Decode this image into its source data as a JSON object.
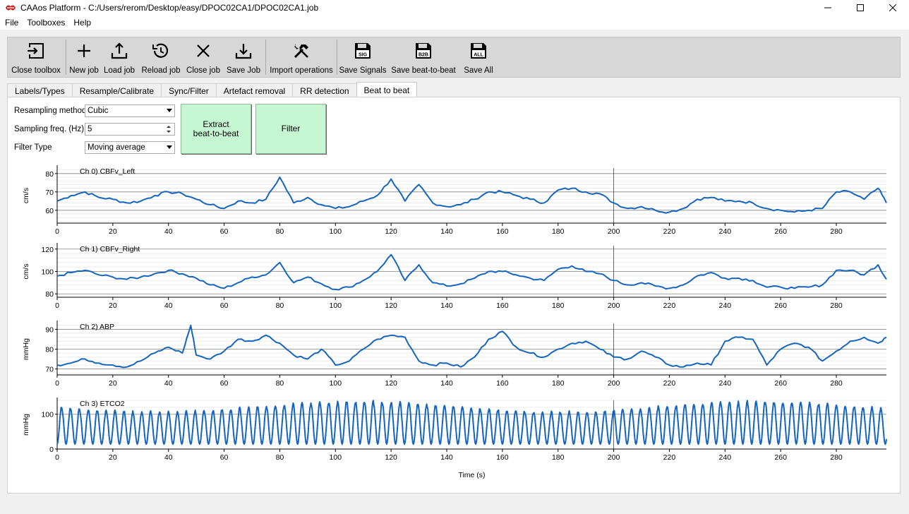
{
  "window": {
    "title": "CAAos Platform - C:/Users/rerom/Desktop/easy/DPOC02CA1/DPOC02CA1.job"
  },
  "menu": [
    "File",
    "Toolboxes",
    "Help"
  ],
  "toolbar": {
    "close_toolbox": "Close toolbox",
    "new_job": "New job",
    "load_job": "Load job",
    "reload_job": "Reload job",
    "close_job": "Close job",
    "save_job": "Save Job",
    "import_operations": "Import operations",
    "save_signals": "Save Signals",
    "save_b2b": "Save beat-to-beat",
    "save_all": "Save All",
    "icon_sig": "SIG",
    "icon_b2b": "B2B",
    "icon_all": "ALL"
  },
  "tabs": [
    "Labels/Types",
    "Resample/Calibrate",
    "Sync/Filter",
    "Artefact removal",
    "RR detection",
    "Beat to beat"
  ],
  "controls": {
    "resampling_method_label": "Resampling method",
    "resampling_method_value": "Cubic",
    "sampling_freq_label": "Sampling freq. (Hz)",
    "sampling_freq_value": "5",
    "filter_type_label": "Filter Type",
    "filter_type_value": "Moving average",
    "extract_btn_line1": "Extract",
    "extract_btn_line2": "beat-to-beat",
    "filter_btn": "Filter"
  },
  "colors": {
    "signal": "#1565c0",
    "action_button": "#c6f7d3"
  },
  "chart_data": [
    {
      "type": "line",
      "title": "Ch 0) CBFv_Left",
      "ylabel": "cm/s",
      "xlim": [
        0,
        298
      ],
      "ylim": [
        53,
        83
      ],
      "yticks": [
        60,
        70,
        80
      ],
      "xticks": [
        0,
        20,
        40,
        60,
        80,
        100,
        120,
        140,
        160,
        180,
        200,
        220,
        240,
        260,
        280
      ],
      "x": [
        0,
        5,
        10,
        15,
        20,
        25,
        30,
        35,
        40,
        45,
        50,
        55,
        60,
        65,
        70,
        75,
        80,
        85,
        90,
        95,
        100,
        105,
        110,
        115,
        120,
        125,
        130,
        135,
        140,
        145,
        150,
        155,
        160,
        165,
        170,
        175,
        180,
        185,
        190,
        195,
        200,
        205,
        210,
        215,
        220,
        225,
        230,
        235,
        240,
        245,
        250,
        255,
        260,
        265,
        270,
        275,
        280,
        285,
        290,
        295,
        298
      ],
      "y": [
        65,
        68,
        70,
        67,
        66,
        64,
        65,
        68,
        70,
        69,
        66,
        63,
        61,
        65,
        64,
        66,
        78,
        64,
        67,
        63,
        61,
        62,
        65,
        68,
        77,
        65,
        74,
        64,
        62,
        63,
        66,
        70,
        70,
        68,
        66,
        64,
        71,
        72,
        70,
        69,
        64,
        61,
        62,
        60,
        59,
        61,
        66,
        67,
        65,
        65,
        64,
        61,
        60,
        59,
        60,
        61,
        70,
        70,
        66,
        72,
        64
      ]
    },
    {
      "type": "line",
      "title": "Ch 1) CBFv_Right",
      "ylabel": "cm/s",
      "xlim": [
        0,
        298
      ],
      "ylim": [
        77,
        123
      ],
      "yticks": [
        80,
        100,
        120
      ],
      "xticks": [
        0,
        20,
        40,
        60,
        80,
        100,
        120,
        140,
        160,
        180,
        200,
        220,
        240,
        260,
        280
      ],
      "x": [
        0,
        5,
        10,
        15,
        20,
        25,
        30,
        35,
        40,
        45,
        50,
        55,
        60,
        65,
        70,
        75,
        80,
        85,
        90,
        95,
        100,
        105,
        110,
        115,
        120,
        125,
        130,
        135,
        140,
        145,
        150,
        155,
        160,
        165,
        170,
        175,
        180,
        185,
        190,
        195,
        200,
        205,
        210,
        215,
        220,
        225,
        230,
        235,
        240,
        245,
        250,
        255,
        260,
        265,
        270,
        275,
        280,
        285,
        290,
        295,
        298
      ],
      "y": [
        96,
        99,
        101,
        97,
        95,
        93,
        95,
        98,
        101,
        98,
        94,
        88,
        85,
        90,
        95,
        97,
        108,
        90,
        95,
        89,
        84,
        86,
        92,
        100,
        115,
        92,
        106,
        90,
        87,
        89,
        94,
        100,
        100,
        97,
        94,
        92,
        102,
        105,
        100,
        98,
        92,
        88,
        90,
        87,
        85,
        88,
        96,
        99,
        94,
        94,
        92,
        86,
        86,
        85,
        86,
        88,
        101,
        101,
        97,
        106,
        93
      ]
    },
    {
      "type": "line",
      "title": "Ch 2) ABP",
      "ylabel": "mmHg",
      "xlim": [
        0,
        298
      ],
      "ylim": [
        67,
        93
      ],
      "yticks": [
        70,
        80,
        90
      ],
      "xticks": [
        0,
        20,
        40,
        60,
        80,
        100,
        120,
        140,
        160,
        180,
        200,
        220,
        240,
        260,
        280
      ],
      "x": [
        0,
        5,
        10,
        15,
        20,
        25,
        30,
        35,
        40,
        45,
        48,
        50,
        55,
        60,
        65,
        70,
        75,
        80,
        85,
        90,
        95,
        100,
        105,
        110,
        115,
        120,
        125,
        130,
        135,
        140,
        145,
        150,
        155,
        160,
        165,
        170,
        175,
        180,
        185,
        190,
        195,
        200,
        205,
        210,
        215,
        220,
        225,
        230,
        235,
        240,
        245,
        250,
        255,
        260,
        265,
        270,
        275,
        280,
        285,
        290,
        295,
        298
      ],
      "y": [
        72,
        73,
        75,
        73,
        72,
        71,
        74,
        78,
        81,
        78,
        92,
        77,
        75,
        79,
        85,
        84,
        87,
        83,
        77,
        75,
        80,
        72,
        74,
        80,
        85,
        87,
        86,
        74,
        72,
        73,
        71,
        76,
        85,
        89,
        81,
        78,
        76,
        80,
        83,
        84,
        80,
        76,
        75,
        79,
        76,
        72,
        71,
        73,
        72,
        84,
        86,
        85,
        72,
        80,
        83,
        81,
        74,
        79,
        84,
        86,
        83,
        86
      ]
    },
    {
      "type": "line",
      "title": "Ch 3) ETCO2",
      "ylabel": "mmHg",
      "xlim": [
        0,
        298
      ],
      "ylim": [
        0,
        140
      ],
      "yticks": [
        0,
        100
      ],
      "xticks": [
        0,
        20,
        40,
        60,
        80,
        100,
        120,
        140,
        160,
        180,
        200,
        220,
        240,
        260,
        280
      ],
      "xlabel": "Time (s)",
      "period_s": 3.2,
      "baseline": 18,
      "peak": 125
    }
  ]
}
